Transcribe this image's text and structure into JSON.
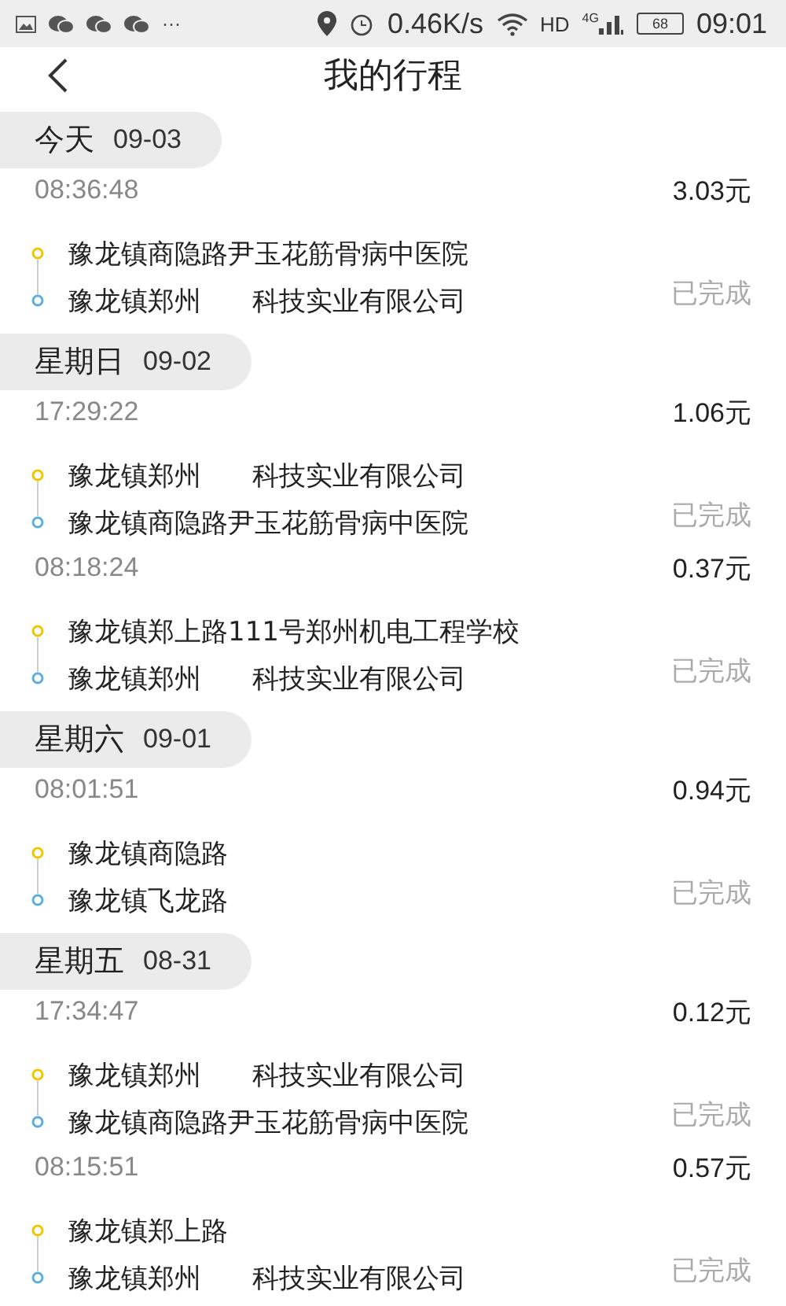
{
  "status_bar": {
    "overflow": "···",
    "speed": "0.46K/s",
    "network": "HD",
    "network_gen": "4G",
    "battery": "68",
    "time": "09:01"
  },
  "header": {
    "title": "我的行程"
  },
  "groups": [
    {
      "day": "今天",
      "date": "09-03",
      "trips": [
        {
          "time": "08:36:48",
          "fare": "3.03元",
          "from": "豫龙镇商隐路尹玉花筋骨病中医院",
          "to": "豫龙镇郑州      科技实业有限公司",
          "status": "已完成"
        }
      ]
    },
    {
      "day": "星期日",
      "date": "09-02",
      "trips": [
        {
          "time": "17:29:22",
          "fare": "1.06元",
          "from": "豫龙镇郑州      科技实业有限公司",
          "to": "豫龙镇商隐路尹玉花筋骨病中医院",
          "status": "已完成"
        },
        {
          "time": "08:18:24",
          "fare": "0.37元",
          "from": "豫龙镇郑上路111号郑州机电工程学校",
          "to": "豫龙镇郑州      科技实业有限公司",
          "status": "已完成"
        }
      ]
    },
    {
      "day": "星期六",
      "date": "09-01",
      "trips": [
        {
          "time": "08:01:51",
          "fare": "0.94元",
          "from": "豫龙镇商隐路",
          "to": "豫龙镇飞龙路",
          "status": "已完成"
        }
      ]
    },
    {
      "day": "星期五",
      "date": "08-31",
      "trips": [
        {
          "time": "17:34:47",
          "fare": "0.12元",
          "from": "豫龙镇郑州      科技实业有限公司",
          "to": "豫龙镇商隐路尹玉花筋骨病中医院",
          "status": "已完成"
        },
        {
          "time": "08:15:51",
          "fare": "0.57元",
          "from": "豫龙镇郑上路",
          "to": "豫龙镇郑州      科技实业有限公司",
          "status": "已完成"
        }
      ]
    }
  ]
}
